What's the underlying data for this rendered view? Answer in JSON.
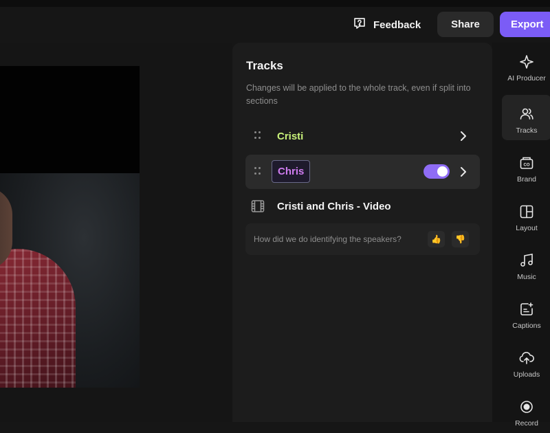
{
  "topbar": {
    "feedback_label": "Feedback",
    "share_label": "Share",
    "export_label": "Export"
  },
  "panel": {
    "title": "Tracks",
    "description": "Changes will be applied to the whole track, even if split into sections",
    "tracks": [
      {
        "name": "Cristi"
      },
      {
        "name": "Chris",
        "enabled": true
      },
      {
        "name": "Cristi and Chris - Video"
      }
    ],
    "feedback_question": "How did we do identifying the speakers?"
  },
  "sidebar": {
    "items": [
      {
        "label": "AI Producer",
        "icon": "sparkle-icon"
      },
      {
        "label": "Tracks",
        "icon": "users-icon",
        "active": true
      },
      {
        "label": "Brand",
        "icon": "brand-kit-icon"
      },
      {
        "label": "Layout",
        "icon": "layout-icon"
      },
      {
        "label": "Music",
        "icon": "music-note-icon"
      },
      {
        "label": "Captions",
        "icon": "captions-icon"
      },
      {
        "label": "Uploads",
        "icon": "upload-cloud-icon"
      },
      {
        "label": "Record",
        "icon": "record-icon"
      }
    ]
  },
  "colors": {
    "accent": "#7b5cf6",
    "toggle": "#8f6cf5",
    "track_green": "#c9f27a",
    "track_magenta": "#cf7cf0"
  }
}
